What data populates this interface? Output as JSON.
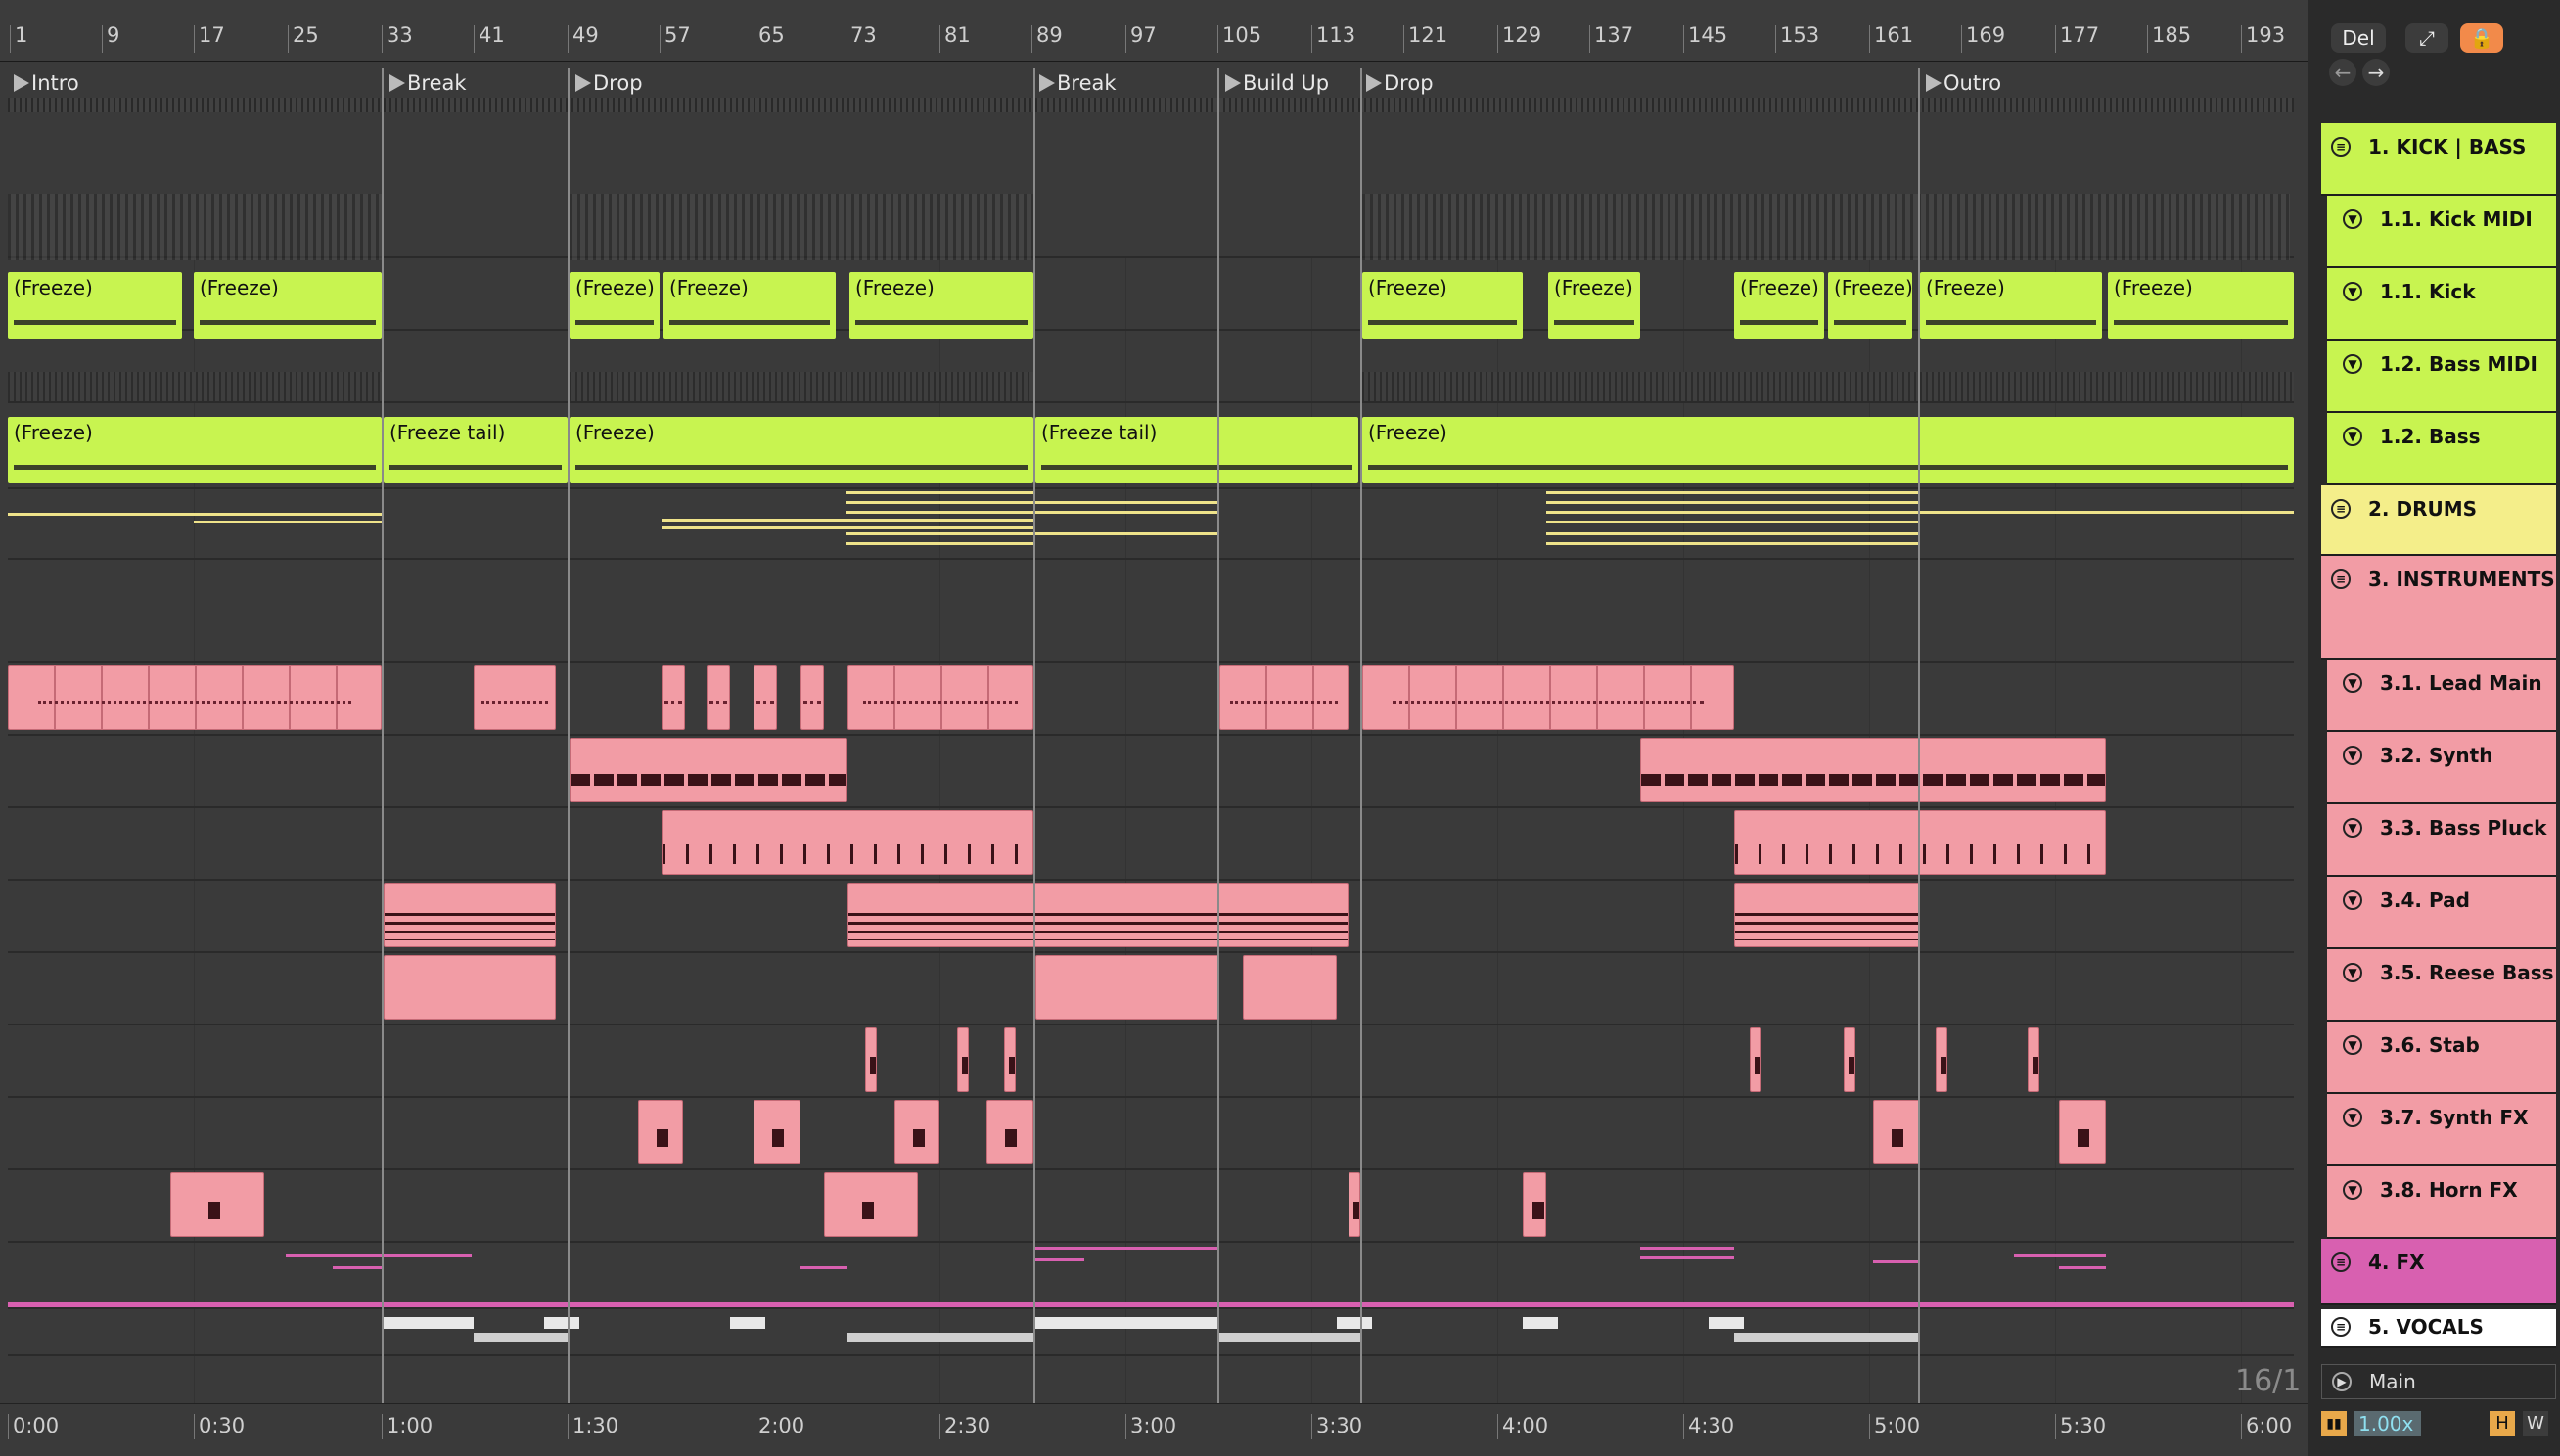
{
  "ruler": [
    "1",
    "9",
    "17",
    "25",
    "33",
    "41",
    "49",
    "57",
    "65",
    "73",
    "81",
    "89",
    "97",
    "105",
    "113",
    "121",
    "129",
    "137",
    "145",
    "153",
    "161",
    "169",
    "177",
    "185",
    "193"
  ],
  "locators": [
    "Intro",
    "Break",
    "Drop",
    "Break",
    "Build Up",
    "Drop",
    "Outro"
  ],
  "clip_labels": {
    "freeze": "(Freeze)",
    "freeze_tail": "(Freeze tail)"
  },
  "timeline": [
    "0:00",
    "0:30",
    "1:00",
    "1:30",
    "2:00",
    "2:30",
    "3:00",
    "3:30",
    "4:00",
    "4:30",
    "5:00",
    "5:30",
    "6:00"
  ],
  "toolbar": {
    "del": "Del"
  },
  "tracks": [
    {
      "name": "1. KICK | BASS",
      "type": "group",
      "color": "#c8f450"
    },
    {
      "name": "1.1. Kick MIDI",
      "type": "sub",
      "color": "#c8f450"
    },
    {
      "name": "1.1. Kick",
      "type": "sub",
      "color": "#c8f450"
    },
    {
      "name": "1.2. Bass MIDI",
      "type": "sub",
      "color": "#c8f450"
    },
    {
      "name": "1.2. Bass",
      "type": "sub",
      "color": "#c8f450"
    },
    {
      "name": "2. DRUMS",
      "type": "group",
      "color": "#f4ee8a"
    },
    {
      "name": "3. INSTRUMENTS",
      "type": "group",
      "color": "#f29ca5"
    },
    {
      "name": "3.1. Lead Main",
      "type": "sub",
      "color": "#f29ca5"
    },
    {
      "name": "3.2. Synth",
      "type": "sub",
      "color": "#f29ca5"
    },
    {
      "name": "3.3. Bass Pluck",
      "type": "sub",
      "color": "#f29ca5"
    },
    {
      "name": "3.4. Pad",
      "type": "sub",
      "color": "#f29ca5"
    },
    {
      "name": "3.5. Reese Bass",
      "type": "sub",
      "color": "#f29ca5"
    },
    {
      "name": "3.6. Stab",
      "type": "sub",
      "color": "#f29ca5"
    },
    {
      "name": "3.7. Synth FX",
      "type": "sub",
      "color": "#f29ca5"
    },
    {
      "name": "3.8. Horn FX",
      "type": "sub",
      "color": "#f29ca5"
    },
    {
      "name": "4. FX",
      "type": "group",
      "color": "#d860b0"
    },
    {
      "name": "5. VOCALS",
      "type": "group",
      "color": "#ffffff"
    },
    {
      "name": "Main",
      "type": "main",
      "color": "#2a2a2a"
    }
  ],
  "footer": {
    "page": "16/1",
    "zoom": "1.00x",
    "h": "H",
    "w": "W"
  }
}
